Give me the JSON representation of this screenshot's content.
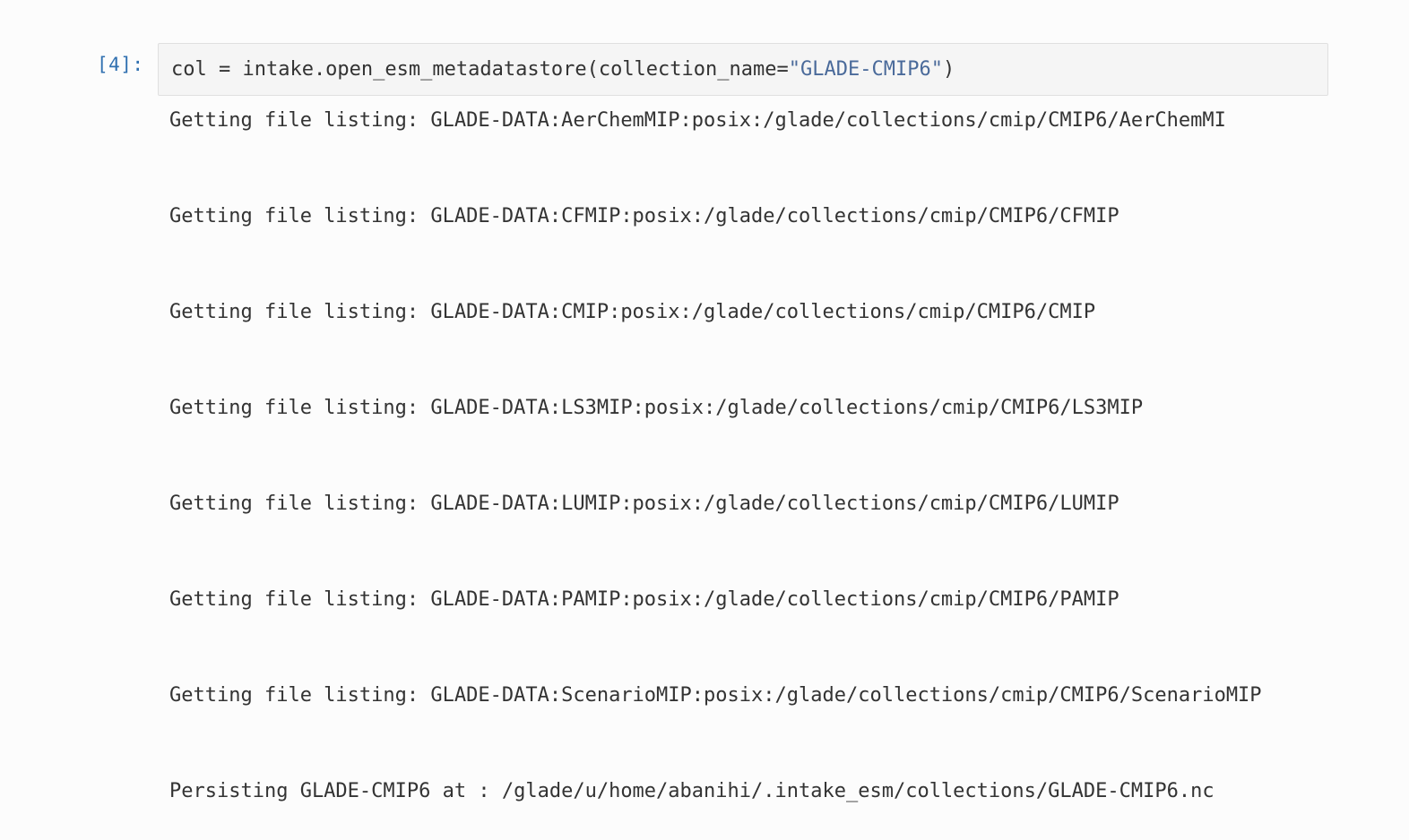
{
  "cell": {
    "prompt": "[4]:",
    "code_prefix": "col = intake.open_esm_metadatastore(collection_name=",
    "code_string": "\"GLADE-CMIP6\"",
    "code_suffix": ")"
  },
  "output": {
    "lines": [
      "Getting file listing: GLADE-DATA:AerChemMIP:posix:/glade/collections/cmip/CMIP6/AerChemMI",
      "Getting file listing: GLADE-DATA:CFMIP:posix:/glade/collections/cmip/CMIP6/CFMIP",
      "Getting file listing: GLADE-DATA:CMIP:posix:/glade/collections/cmip/CMIP6/CMIP",
      "Getting file listing: GLADE-DATA:LS3MIP:posix:/glade/collections/cmip/CMIP6/LS3MIP",
      "Getting file listing: GLADE-DATA:LUMIP:posix:/glade/collections/cmip/CMIP6/LUMIP",
      "Getting file listing: GLADE-DATA:PAMIP:posix:/glade/collections/cmip/CMIP6/PAMIP",
      "Getting file listing: GLADE-DATA:ScenarioMIP:posix:/glade/collections/cmip/CMIP6/ScenarioMIP",
      "Persisting GLADE-CMIP6 at : /glade/u/home/abanihi/.intake_esm/collections/GLADE-CMIP6.nc"
    ]
  },
  "colors": {
    "prompt": "#3070b0",
    "string": "#4a6a9a",
    "text": "#333333",
    "input_bg": "#f5f5f5"
  }
}
